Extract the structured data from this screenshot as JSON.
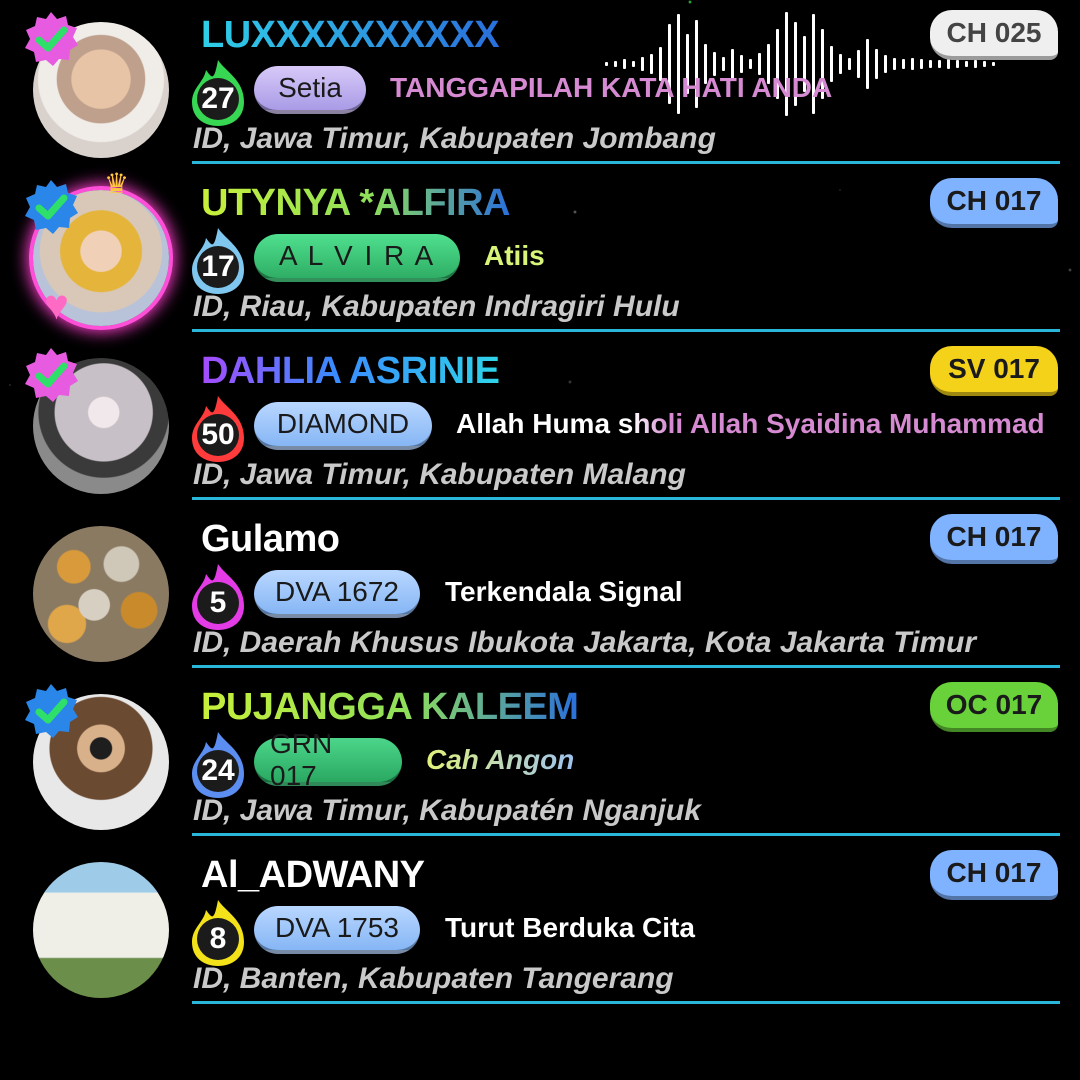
{
  "entries": [
    {
      "name": "LUXXXXXXXXXX",
      "channel": "CH 025",
      "level": "27",
      "badge": "Setia",
      "message": "TANGGAPILAH KATA HATI ANDA",
      "location": "ID, Jawa Timur, Kabupaten Jombang",
      "verified": "pink",
      "flame_color": "#37d653",
      "chip_color": "#efefef",
      "badge_color": "#c9b5f2",
      "name_color": "#29d3e6",
      "message_color": "#d58ad1"
    },
    {
      "name": "UTYNYA *ALFIRA",
      "channel": "CH 017",
      "level": "17",
      "badge": "A L V I R A",
      "message": "Atiis",
      "location": "ID, Riau, Kabupaten Indragiri Hulu",
      "verified": "blue",
      "flame_color": "#7fc7ee",
      "chip_color": "#7fb2ff",
      "badge_color": "#3ad17c",
      "name_color": "#b6ef3b",
      "message_color": "#d8f57a"
    },
    {
      "name": "DAHLIA ASRINIE",
      "channel": "SV 017",
      "level": "50",
      "badge": "DIAMOND",
      "message": "Allah Huma sholi Allah Syaidina Muhammad",
      "location": "ID, Jawa Timur, Kabupaten Malang",
      "verified": "pink",
      "flame_color": "#ff3b3b",
      "chip_color": "#f4d21a",
      "badge_color": "#9fc8ff",
      "name_color": "#b05bff",
      "message_color": "#d58ad1"
    },
    {
      "name": "Gulamo",
      "channel": "CH 017",
      "level": "5",
      "badge": "DVA 1672",
      "message": "Terkendala Signal",
      "location": "ID, Daerah Khusus Ibukota Jakarta, Kota Jakarta Timur",
      "verified": "",
      "flame_color": "#e33be6",
      "chip_color": "#7fb2ff",
      "badge_color": "#9fc8ff",
      "name_color": "#ffffff",
      "message_color": "#ffffff"
    },
    {
      "name": "PUJANGGA KALEEM",
      "channel": "OC 017",
      "level": "24",
      "badge": "GRN 017",
      "message": "Cah Angon",
      "location": "ID, Jawa Timur, Kabupatén Nganjuk",
      "verified": "blue",
      "flame_color": "#5b8ef0",
      "chip_color": "#69d13a",
      "badge_color": "#38c476",
      "name_color": "#b6ef3b",
      "message_color": "#d7ef8a"
    },
    {
      "name": "Al_ADWANY",
      "channel": "CH 017",
      "level": "8",
      "badge": "DVA 1753",
      "message": "Turut Berduka Cita",
      "location": "ID, Banten, Kabupaten Tangerang",
      "verified": "",
      "flame_color": "#f3e21a",
      "chip_color": "#7fb2ff",
      "badge_color": "#9fc8ff",
      "name_color": "#ffffff",
      "message_color": "#ffffff"
    }
  ]
}
